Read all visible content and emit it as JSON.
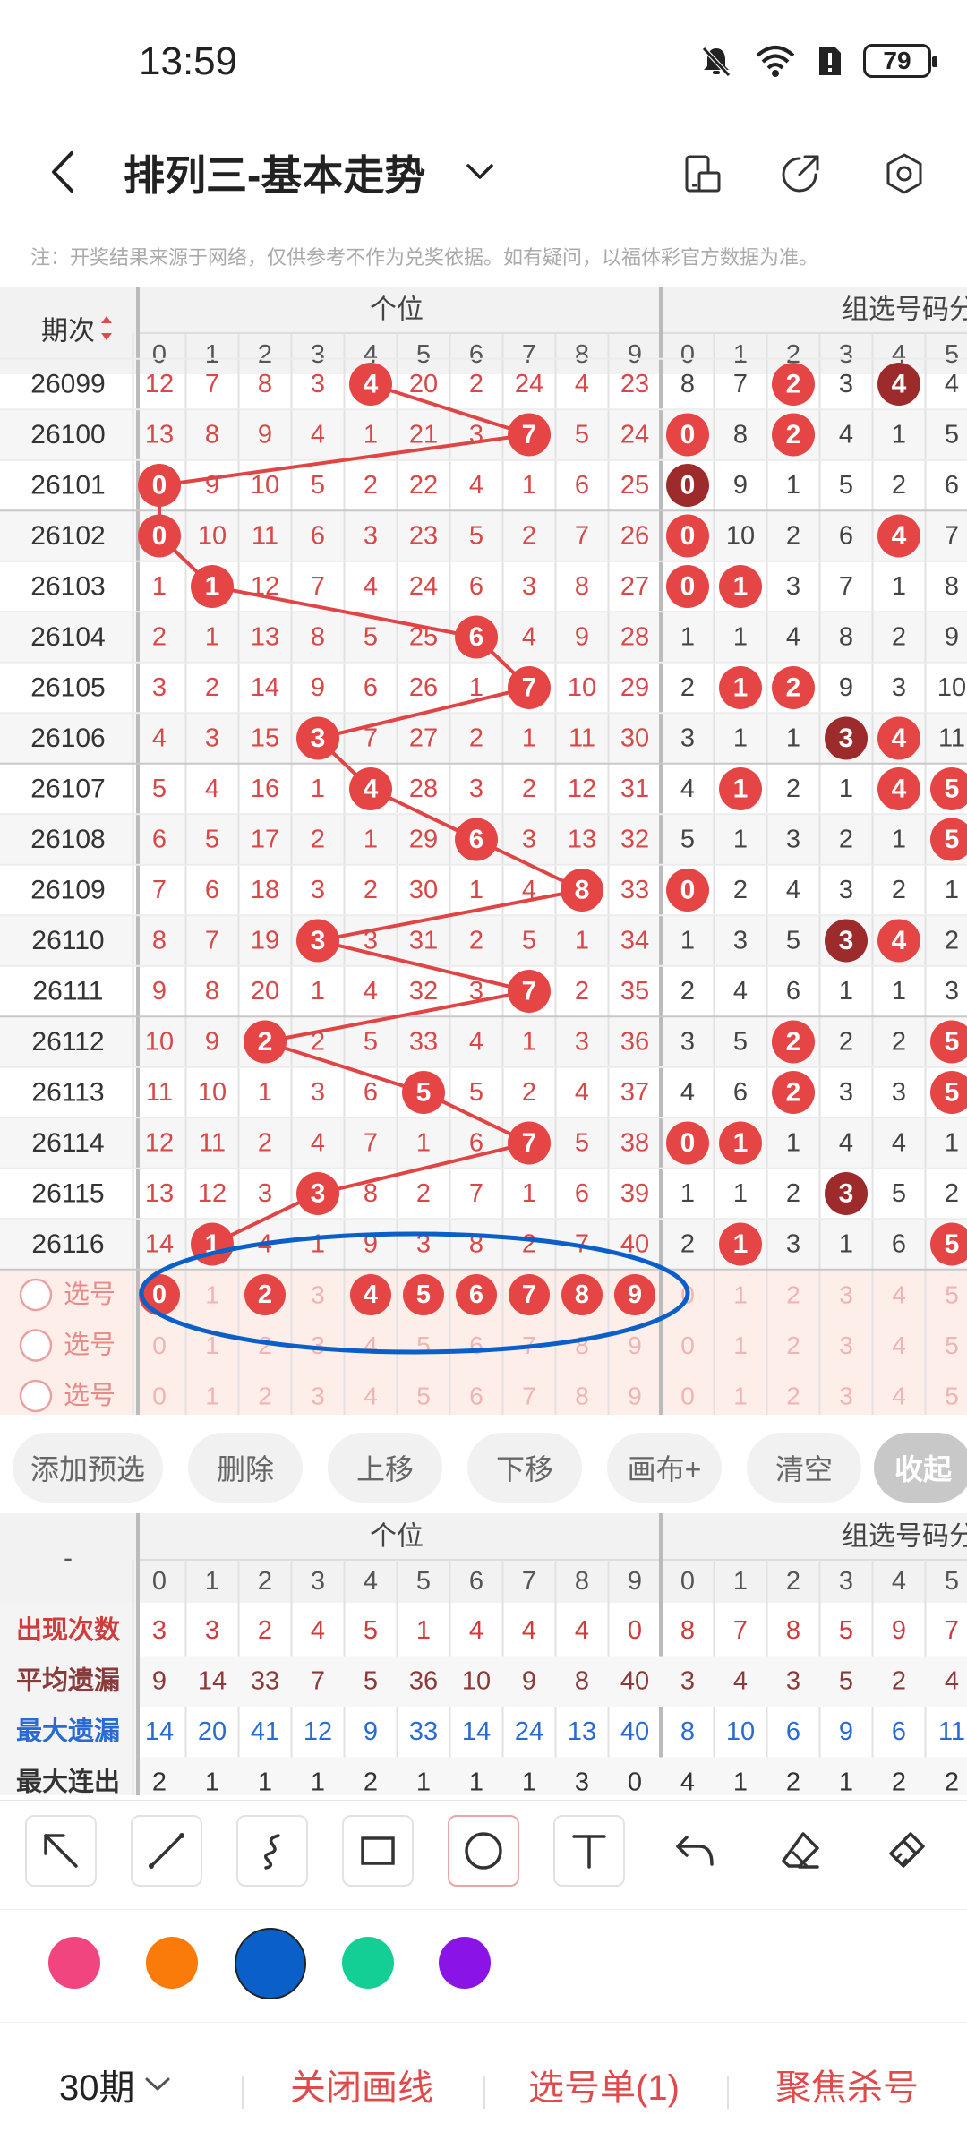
{
  "status_bar": {
    "time": "13:59",
    "battery": "79"
  },
  "header": {
    "title": "排列三-基本走势"
  },
  "notice": "注：开奖结果来源于网络，仅供参考不作为兑奖依据。如有疑问，以福体彩官方数据为准。",
  "chart": {
    "period_header": "期次",
    "sections": [
      "个位",
      "组选号码分"
    ],
    "digit_headers": [
      "0",
      "1",
      "2",
      "3",
      "4",
      "5",
      "6",
      "7",
      "8",
      "9",
      "0",
      "1",
      "2",
      "3",
      "4",
      "5"
    ],
    "periods": [
      "26099",
      "26100",
      "26101",
      "26102",
      "26103",
      "26104",
      "26105",
      "26106",
      "26107",
      "26108",
      "26109",
      "26110",
      "26111",
      "26112",
      "26113",
      "26114",
      "26115",
      "26116"
    ],
    "rows": [
      {
        "units": [
          "12",
          "7",
          "8",
          "3",
          "4",
          "20",
          "2",
          "24",
          "4",
          "23"
        ],
        "drawn": 4,
        "group": [
          "8",
          "7",
          "2",
          "3",
          "4",
          "4"
        ],
        "group_hits": {
          "2": "r",
          "4": "d"
        }
      },
      {
        "units": [
          "13",
          "8",
          "9",
          "4",
          "1",
          "21",
          "3",
          "7",
          "5",
          "24"
        ],
        "drawn": 7,
        "group": [
          "0",
          "8",
          "2",
          "4",
          "1",
          "5"
        ],
        "group_hits": {
          "0": "r",
          "2": "r"
        }
      },
      {
        "units": [
          "0",
          "9",
          "10",
          "5",
          "2",
          "22",
          "4",
          "1",
          "6",
          "25"
        ],
        "drawn": 0,
        "group": [
          "0",
          "9",
          "1",
          "5",
          "2",
          "6"
        ],
        "group_hits": {
          "0": "d"
        }
      },
      {
        "units": [
          "0",
          "10",
          "11",
          "6",
          "3",
          "23",
          "5",
          "2",
          "7",
          "26"
        ],
        "drawn": 0,
        "group": [
          "0",
          "10",
          "2",
          "6",
          "4",
          "7"
        ],
        "group_hits": {
          "0": "r",
          "4": "r"
        }
      },
      {
        "units": [
          "1",
          "1",
          "12",
          "7",
          "4",
          "24",
          "6",
          "3",
          "8",
          "27"
        ],
        "drawn": 1,
        "group": [
          "0",
          "1",
          "3",
          "7",
          "1",
          "8"
        ],
        "group_hits": {
          "0": "r",
          "1": "r"
        }
      },
      {
        "units": [
          "2",
          "1",
          "13",
          "8",
          "5",
          "25",
          "6",
          "4",
          "9",
          "28"
        ],
        "drawn": 6,
        "group": [
          "1",
          "1",
          "4",
          "8",
          "2",
          "9"
        ],
        "group_hits": {}
      },
      {
        "units": [
          "3",
          "2",
          "14",
          "9",
          "6",
          "26",
          "1",
          "7",
          "10",
          "29"
        ],
        "drawn": 7,
        "group": [
          "2",
          "1",
          "2",
          "9",
          "3",
          "10"
        ],
        "group_hits": {
          "1": "r",
          "2": "r"
        }
      },
      {
        "units": [
          "4",
          "3",
          "15",
          "3",
          "7",
          "27",
          "2",
          "1",
          "11",
          "30"
        ],
        "drawn": 3,
        "group": [
          "3",
          "1",
          "1",
          "3",
          "4",
          "11"
        ],
        "group_hits": {
          "3": "d",
          "4": "r"
        }
      },
      {
        "units": [
          "5",
          "4",
          "16",
          "1",
          "4",
          "28",
          "3",
          "2",
          "12",
          "31"
        ],
        "drawn": 4,
        "group": [
          "4",
          "1",
          "2",
          "1",
          "4",
          "5"
        ],
        "group_hits": {
          "1": "r",
          "4": "r",
          "5": "r"
        }
      },
      {
        "units": [
          "6",
          "5",
          "17",
          "2",
          "1",
          "29",
          "6",
          "3",
          "13",
          "32"
        ],
        "drawn": 6,
        "group": [
          "5",
          "1",
          "3",
          "2",
          "1",
          "5"
        ],
        "group_hits": {
          "5": "r"
        }
      },
      {
        "units": [
          "7",
          "6",
          "18",
          "3",
          "2",
          "30",
          "1",
          "4",
          "8",
          "33"
        ],
        "drawn": 8,
        "group": [
          "0",
          "2",
          "4",
          "3",
          "2",
          "1"
        ],
        "group_hits": {
          "0": "r"
        }
      },
      {
        "units": [
          "8",
          "7",
          "19",
          "3",
          "3",
          "31",
          "2",
          "5",
          "1",
          "34"
        ],
        "drawn": 3,
        "group": [
          "1",
          "3",
          "5",
          "3",
          "4",
          "2"
        ],
        "group_hits": {
          "3": "d",
          "4": "r"
        }
      },
      {
        "units": [
          "9",
          "8",
          "20",
          "1",
          "4",
          "32",
          "3",
          "7",
          "2",
          "35"
        ],
        "drawn": 7,
        "group": [
          "2",
          "4",
          "6",
          "1",
          "1",
          "3"
        ],
        "group_hits": {}
      },
      {
        "units": [
          "10",
          "9",
          "2",
          "2",
          "5",
          "33",
          "4",
          "1",
          "3",
          "36"
        ],
        "drawn": 2,
        "group": [
          "3",
          "5",
          "2",
          "2",
          "2",
          "5"
        ],
        "group_hits": {
          "2": "r",
          "5": "r"
        }
      },
      {
        "units": [
          "11",
          "10",
          "1",
          "3",
          "6",
          "5",
          "5",
          "2",
          "4",
          "37"
        ],
        "drawn": 5,
        "group": [
          "4",
          "6",
          "2",
          "3",
          "3",
          "5"
        ],
        "group_hits": {
          "2": "r",
          "5": "r"
        }
      },
      {
        "units": [
          "12",
          "11",
          "2",
          "4",
          "7",
          "1",
          "6",
          "7",
          "5",
          "38"
        ],
        "drawn": 7,
        "group": [
          "0",
          "1",
          "1",
          "4",
          "4",
          "1"
        ],
        "group_hits": {
          "0": "r",
          "1": "r"
        }
      },
      {
        "units": [
          "13",
          "12",
          "3",
          "3",
          "8",
          "2",
          "7",
          "1",
          "6",
          "39"
        ],
        "drawn": 3,
        "group": [
          "1",
          "1",
          "2",
          "3",
          "5",
          "2"
        ],
        "group_hits": {
          "3": "d"
        }
      },
      {
        "units": [
          "14",
          "1",
          "4",
          "1",
          "9",
          "3",
          "8",
          "2",
          "7",
          "40"
        ],
        "drawn": 1,
        "group": [
          "2",
          "1",
          "3",
          "1",
          "6",
          "5"
        ],
        "group_hits": {
          "1": "r",
          "5": "r"
        }
      }
    ],
    "select_label": "选号",
    "select_rows": [
      {
        "selected": [
          0,
          2,
          4,
          5,
          6,
          7,
          8,
          9
        ]
      },
      {
        "selected": []
      },
      {
        "selected": []
      }
    ]
  },
  "buttons": [
    "添加预选",
    "删除",
    "上移",
    "下移",
    "画布+",
    "清空",
    "收起"
  ],
  "stats": {
    "corner": "-",
    "sections": [
      "个位",
      "组选号码分"
    ],
    "rows": [
      {
        "label": "出现次数",
        "color": "#d23b3b",
        "values": [
          "3",
          "3",
          "2",
          "4",
          "5",
          "1",
          "4",
          "4",
          "4",
          "0",
          "8",
          "7",
          "8",
          "5",
          "9",
          "7"
        ]
      },
      {
        "label": "平均遗漏",
        "color": "#8a3a3a",
        "values": [
          "9",
          "14",
          "33",
          "7",
          "5",
          "36",
          "10",
          "9",
          "8",
          "40",
          "3",
          "4",
          "3",
          "5",
          "2",
          "4"
        ]
      },
      {
        "label": "最大遗漏",
        "color": "#2a6bd1",
        "values": [
          "14",
          "20",
          "41",
          "12",
          "9",
          "33",
          "14",
          "24",
          "13",
          "40",
          "8",
          "10",
          "6",
          "9",
          "6",
          "11"
        ]
      },
      {
        "label": "最大连出",
        "color": "#333333",
        "values": [
          "2",
          "1",
          "1",
          "1",
          "2",
          "1",
          "1",
          "1",
          "3",
          "0",
          "4",
          "1",
          "2",
          "1",
          "2",
          "2"
        ]
      }
    ]
  },
  "tools": [
    "arrow-tool",
    "line-tool",
    "curve-tool",
    "rectangle-tool",
    "ellipse-tool",
    "text-tool",
    "undo",
    "eraser",
    "clear-brush"
  ],
  "colors": [
    "#f0457f",
    "#fa7a0a",
    "#0a5fc8",
    "#14cf95",
    "#8a14e6"
  ],
  "selected_color": "#0a5fc8",
  "bottom": {
    "period": "30期",
    "actions": [
      "关闭画线",
      "选号单(1)",
      "聚焦杀号"
    ]
  }
}
